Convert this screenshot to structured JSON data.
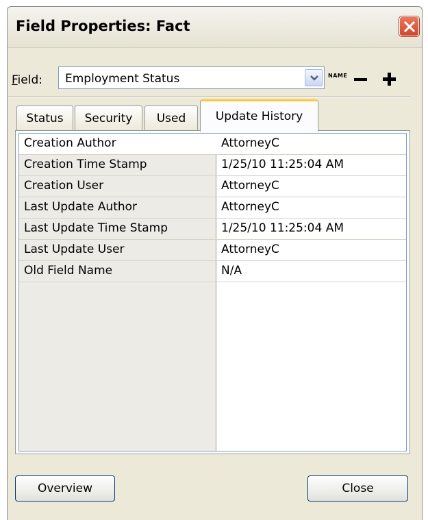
{
  "window": {
    "title": "Field Properties: Fact"
  },
  "field": {
    "label": "Field:",
    "accesskey": "F",
    "label_rest": "ield:",
    "value": "Employment Status",
    "name_button": "NAME"
  },
  "tabs": [
    {
      "label": "Status",
      "active": false
    },
    {
      "label": "Security",
      "active": false
    },
    {
      "label": "Used",
      "active": false
    },
    {
      "label": "Update History",
      "active": true
    }
  ],
  "properties": [
    {
      "name": "Creation Author",
      "value": "AttorneyC"
    },
    {
      "name": "Creation Time Stamp",
      "value": "1/25/10 11:25:04 AM"
    },
    {
      "name": "Creation User",
      "value": "AttorneyC"
    },
    {
      "name": "Last Update Author",
      "value": "AttorneyC"
    },
    {
      "name": "Last Update Time Stamp",
      "value": "1/25/10 11:25:04 AM"
    },
    {
      "name": "Last Update User",
      "value": "AttorneyC"
    },
    {
      "name": "Old Field Name",
      "value": "N/A"
    }
  ],
  "buttons": {
    "overview": "Overview",
    "close": "Close"
  },
  "icons": {
    "close": "close-icon",
    "dropdown": "chevron-down-icon",
    "remove": "minus-icon",
    "add": "plus-icon"
  },
  "colors": {
    "dialog_bg": "#ece9d8",
    "close_button": "#d0472a",
    "active_tab_accent": "#ffc83c",
    "grid_border": "#7f9db9"
  }
}
